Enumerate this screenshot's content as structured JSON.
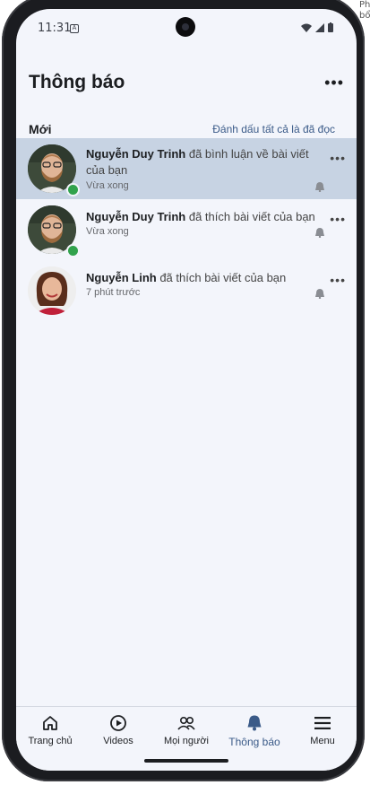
{
  "side_text": [
    "Ph",
    "bổ"
  ],
  "status_bar": {
    "time": "11:31",
    "a_badge": "A"
  },
  "header": {
    "title": "Thông báo",
    "more": "•••"
  },
  "section": {
    "label": "Mới",
    "mark_all_read": "Đánh dấu tất cả là đã đọc"
  },
  "notifications": [
    {
      "name": "Nguyễn Duy Trinh",
      "action": " đã bình luận về bài viết của bạn",
      "time": "Vừa xong",
      "highlighted": true,
      "online": true
    },
    {
      "name": "Nguyễn Duy Trinh",
      "action": " đã thích bài viết của bạn",
      "time": "Vừa xong",
      "highlighted": false,
      "online": true
    },
    {
      "name": "Nguyễn Linh",
      "action": " đã thích bài viết của bạn",
      "time": "7 phút trước",
      "highlighted": false,
      "online": false
    }
  ],
  "notification_more": "•••",
  "bottom_nav": [
    {
      "label": "Trang chủ",
      "icon": "home-icon",
      "active": false
    },
    {
      "label": "Videos",
      "icon": "play-circle-icon",
      "active": false
    },
    {
      "label": "Mọi người",
      "icon": "people-icon",
      "active": false
    },
    {
      "label": "Thông báo",
      "icon": "bell-icon",
      "active": true
    },
    {
      "label": "Menu",
      "icon": "menu-icon",
      "active": false
    }
  ],
  "colors": {
    "accent": "#3a5a88",
    "highlight": "#c7d3e3",
    "online": "#31a24c",
    "background": "#f3f5fb"
  }
}
